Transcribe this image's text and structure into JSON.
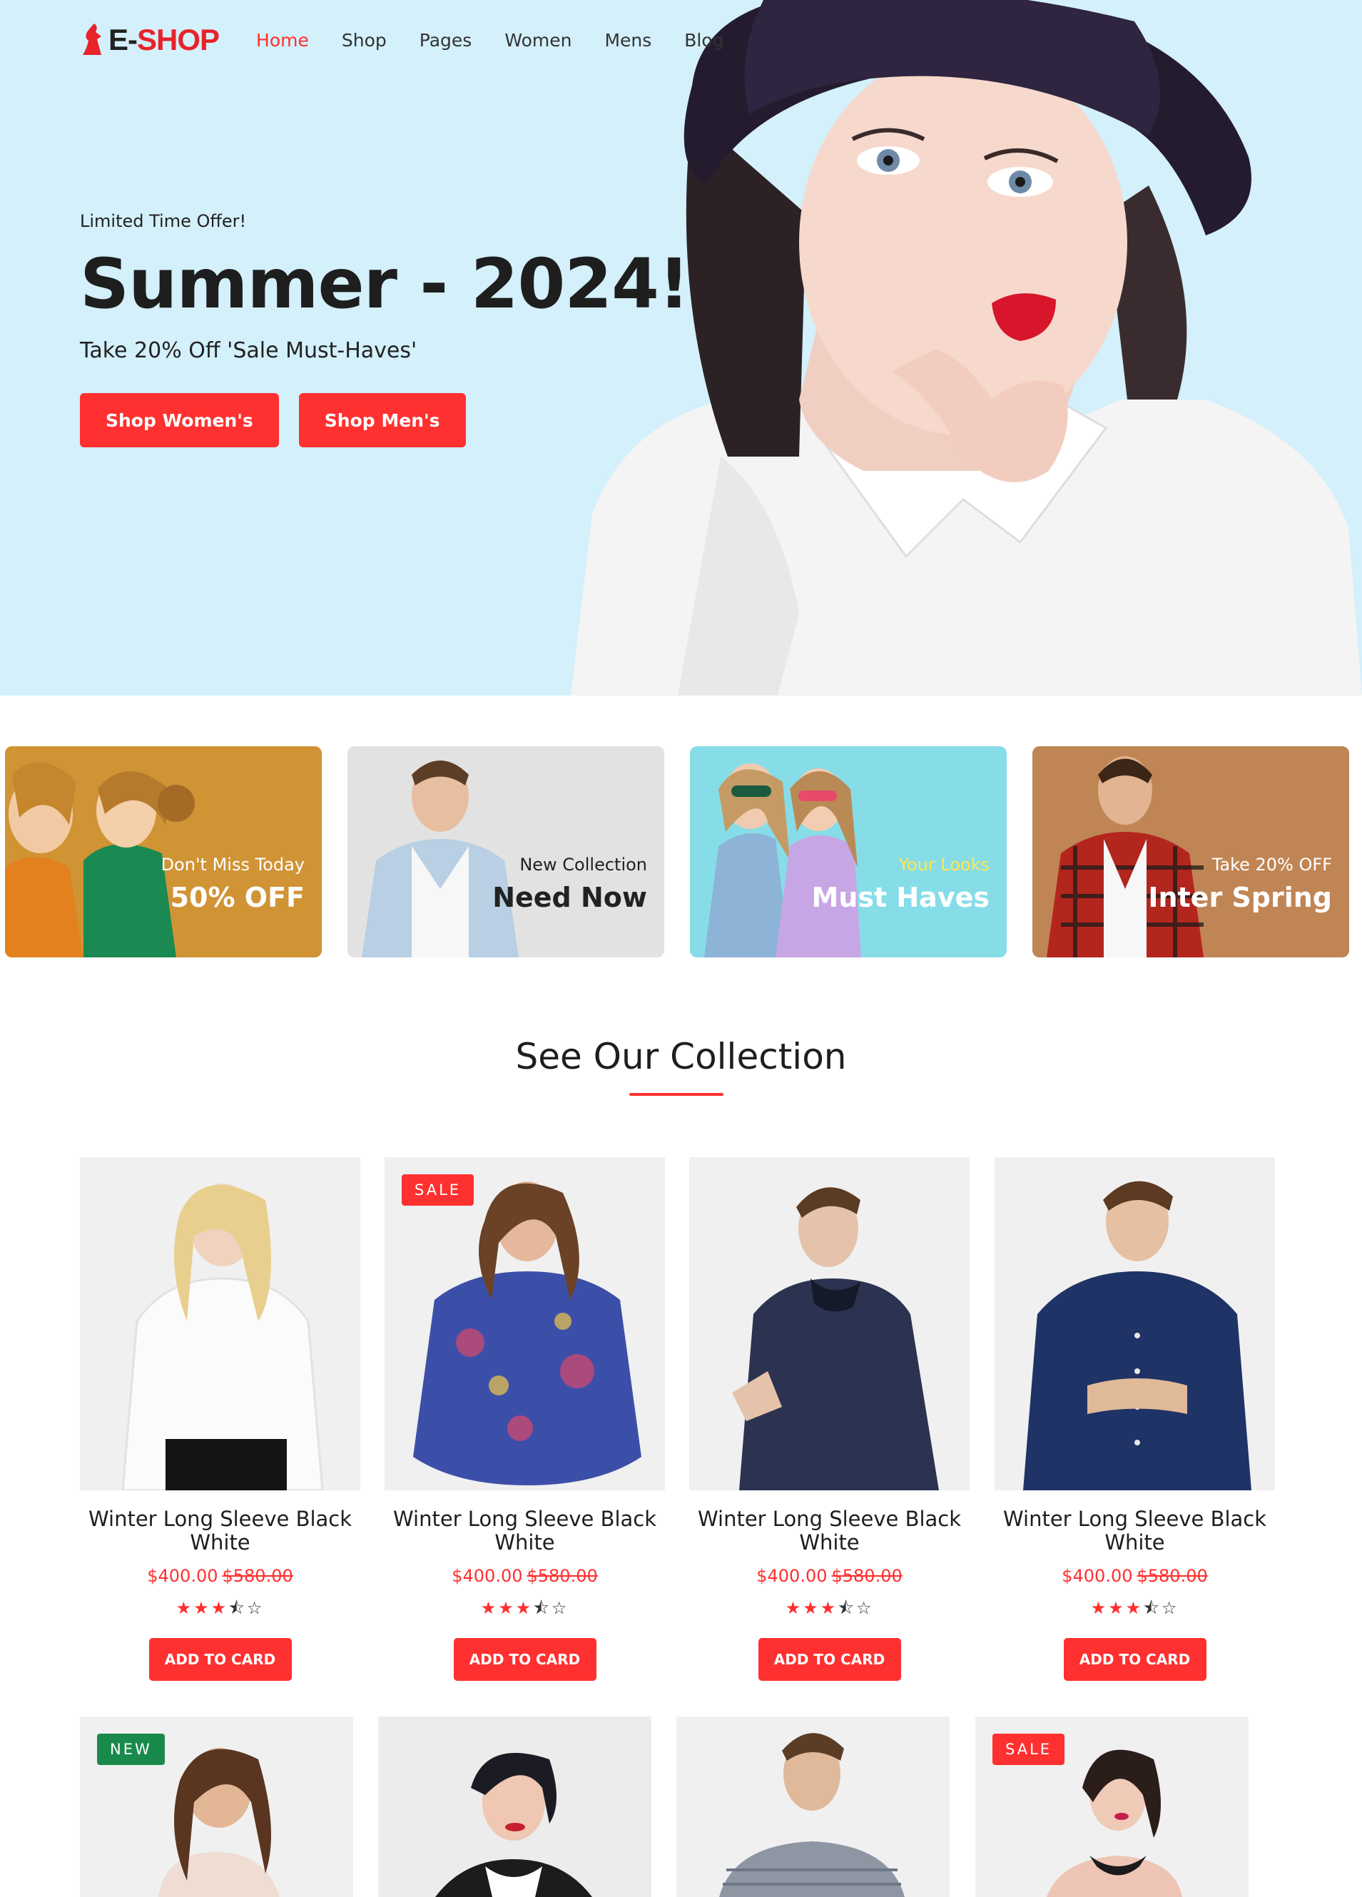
{
  "brand": {
    "logo_prefix": "E-",
    "logo_name": "SHOP"
  },
  "nav": {
    "items": [
      {
        "label": "Home",
        "active": true
      },
      {
        "label": "Shop"
      },
      {
        "label": "Pages"
      },
      {
        "label": "Women"
      },
      {
        "label": "Mens"
      },
      {
        "label": "Blog"
      }
    ]
  },
  "hero": {
    "kicker": "Limited Time Offer!",
    "title": "Summer - 2024!",
    "subtitle": "Take 20% Off 'Sale Must-Haves'",
    "buttons": [
      "Shop Women's",
      "Shop Men's"
    ],
    "background_color": "#d3f0fb"
  },
  "promos": [
    {
      "small": "Don't Miss Today",
      "big": "50% OFF"
    },
    {
      "small": "New Collection",
      "big": "Need Now"
    },
    {
      "small": "Your Looks",
      "big": "Must Haves"
    },
    {
      "small": "Take 20% OFF",
      "big": "Inter Spring"
    }
  ],
  "collection": {
    "title": "See Our Collection",
    "products": [
      {
        "name": "Winter Long Sleeve Black White",
        "price": "$400.00",
        "old_price": "$580.00",
        "rating": 3.5,
        "button": "ADD TO CARD",
        "badge": ""
      },
      {
        "name": "Winter Long Sleeve Black White",
        "price": "$400.00",
        "old_price": "$580.00",
        "rating": 3.5,
        "button": "ADD TO CARD",
        "badge": "SALE"
      },
      {
        "name": "Winter Long Sleeve Black White",
        "price": "$400.00",
        "old_price": "$580.00",
        "rating": 3.5,
        "button": "ADD TO CARD",
        "badge": ""
      },
      {
        "name": "Winter Long Sleeve Black White",
        "price": "$400.00",
        "old_price": "$580.00",
        "rating": 3.5,
        "button": "ADD TO CARD",
        "badge": ""
      }
    ],
    "row2_badges": [
      "NEW",
      "",
      "",
      "SALE"
    ]
  },
  "colors": {
    "accent": "#ff3030",
    "new_badge": "#1a8a4c",
    "text": "#1e1e1e"
  }
}
